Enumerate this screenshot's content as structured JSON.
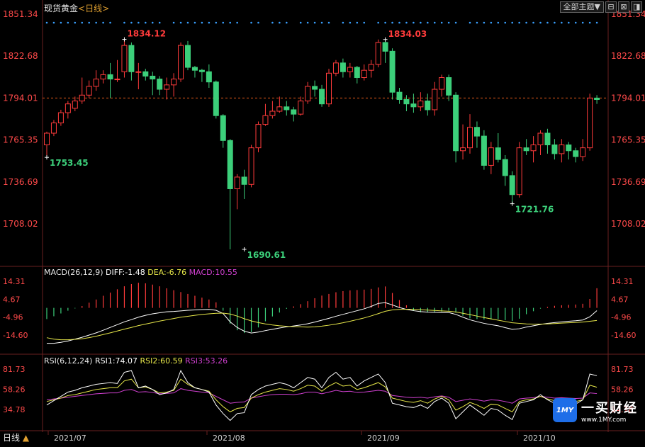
{
  "header": {
    "title": "现货黄金",
    "period": "<日线>"
  },
  "toolbar": {
    "theme_label": "全部主题▼",
    "b1": "⊟",
    "b2": "⊠",
    "b3": "◨"
  },
  "timeframe": {
    "label": "日线",
    "arrow": "▲"
  },
  "brand": {
    "logo_text": "1MY",
    "name": "一买财经",
    "url": "www.1MY.com"
  },
  "colors": {
    "up": "#ff3b3b",
    "down": "#3ccf7a",
    "axis_text": "#ff4a4a",
    "ref_line": "#e05a1a",
    "diff": "#ffffff",
    "dea": "#e8e84a",
    "macd": "#d040d0",
    "rsi1": "#ffffff",
    "rsi2": "#e8e84a",
    "rsi3": "#d040d0",
    "dots": "#3aa0ff"
  },
  "chart_data": [
    {
      "name": "price",
      "type": "candlestick",
      "y_ticks": [
        "1851.34",
        "1822.68",
        "1794.01",
        "1765.35",
        "1736.69",
        "1708.02"
      ],
      "ylim": [
        1690.61,
        1851.34
      ],
      "reference_line": 1794.01,
      "x_ticks": [
        "2021/07",
        "2021/08",
        "2021/09",
        "2021/10"
      ],
      "annotations": [
        {
          "label": "1834.12",
          "value": 1834.12,
          "index": 11,
          "kind": "high"
        },
        {
          "label": "1753.45",
          "value": 1753.45,
          "index": 0,
          "kind": "low"
        },
        {
          "label": "1690.61",
          "value": 1690.61,
          "index": 28,
          "kind": "low"
        },
        {
          "label": "1834.03",
          "value": 1834.03,
          "index": 48,
          "kind": "high"
        },
        {
          "label": "1721.76",
          "value": 1721.76,
          "index": 66,
          "kind": "low"
        }
      ],
      "candles": [
        [
          1762,
          1770,
          1753.45,
          1771
        ],
        [
          1770,
          1777,
          1768,
          1779
        ],
        [
          1777,
          1784,
          1775,
          1786
        ],
        [
          1784,
          1790,
          1780,
          1792
        ],
        [
          1787,
          1792,
          1785,
          1795
        ],
        [
          1792,
          1796,
          1790,
          1808
        ],
        [
          1796,
          1802,
          1794,
          1806
        ],
        [
          1802,
          1807,
          1799,
          1813
        ],
        [
          1807,
          1810,
          1804,
          1813
        ],
        [
          1810,
          1807,
          1794,
          1818
        ],
        [
          1807,
          1807,
          1805,
          1820
        ],
        [
          1812,
          1830,
          1808,
          1834.12
        ],
        [
          1830,
          1812,
          1806,
          1832
        ],
        [
          1812,
          1812,
          1800,
          1818
        ],
        [
          1812,
          1809,
          1806,
          1814
        ],
        [
          1809,
          1807,
          1796,
          1812
        ],
        [
          1807,
          1800,
          1796,
          1809
        ],
        [
          1800,
          1803,
          1793,
          1808
        ],
        [
          1803,
          1807,
          1795,
          1811
        ],
        [
          1807,
          1830,
          1805,
          1832
        ],
        [
          1830,
          1815,
          1813,
          1833
        ],
        [
          1815,
          1813,
          1808,
          1816
        ],
        [
          1813,
          1812,
          1805,
          1814
        ],
        [
          1812,
          1805,
          1801,
          1817
        ],
        [
          1805,
          1782,
          1780,
          1806
        ],
        [
          1782,
          1765,
          1760,
          1783
        ],
        [
          1765,
          1732,
          1690.61,
          1766
        ],
        [
          1732,
          1740,
          1718,
          1742
        ],
        [
          1740,
          1735,
          1725,
          1745
        ],
        [
          1735,
          1760,
          1733,
          1762
        ],
        [
          1760,
          1776,
          1757,
          1778
        ],
        [
          1776,
          1782,
          1775,
          1790
        ],
        [
          1782,
          1785,
          1780,
          1792
        ],
        [
          1785,
          1788,
          1784,
          1795
        ],
        [
          1788,
          1786,
          1782,
          1792
        ],
        [
          1786,
          1783,
          1778,
          1788
        ],
        [
          1783,
          1792,
          1782,
          1795
        ],
        [
          1792,
          1802,
          1790,
          1805
        ],
        [
          1802,
          1800,
          1795,
          1806
        ],
        [
          1800,
          1790,
          1788,
          1803
        ],
        [
          1790,
          1811,
          1788,
          1814
        ],
        [
          1811,
          1818,
          1809,
          1820
        ],
        [
          1818,
          1812,
          1808,
          1821
        ],
        [
          1812,
          1815,
          1808,
          1818
        ],
        [
          1815,
          1808,
          1804,
          1816
        ],
        [
          1808,
          1813,
          1806,
          1817
        ],
        [
          1813,
          1817,
          1808,
          1820
        ],
        [
          1817,
          1832,
          1815,
          1834.03
        ],
        [
          1832,
          1826,
          1818,
          1833
        ],
        [
          1826,
          1798,
          1793,
          1828
        ],
        [
          1798,
          1793,
          1790,
          1801
        ],
        [
          1793,
          1790,
          1785,
          1796
        ],
        [
          1790,
          1788,
          1784,
          1797
        ],
        [
          1788,
          1792,
          1785,
          1798
        ],
        [
          1792,
          1786,
          1782,
          1797
        ],
        [
          1786,
          1800,
          1782,
          1805
        ],
        [
          1800,
          1808,
          1795,
          1810
        ],
        [
          1808,
          1796,
          1792,
          1810
        ],
        [
          1796,
          1758,
          1750,
          1798
        ],
        [
          1758,
          1760,
          1752,
          1776
        ],
        [
          1760,
          1774,
          1756,
          1783
        ],
        [
          1774,
          1768,
          1760,
          1778
        ],
        [
          1768,
          1748,
          1745,
          1772
        ],
        [
          1748,
          1760,
          1742,
          1764
        ],
        [
          1760,
          1752,
          1750,
          1770
        ],
        [
          1752,
          1741,
          1734,
          1755
        ],
        [
          1741,
          1728,
          1721.76,
          1744
        ],
        [
          1728,
          1760,
          1726,
          1764
        ],
        [
          1760,
          1758,
          1755,
          1766
        ],
        [
          1758,
          1762,
          1750,
          1768
        ],
        [
          1762,
          1770,
          1755,
          1772
        ],
        [
          1770,
          1762,
          1756,
          1773
        ],
        [
          1762,
          1756,
          1752,
          1766
        ],
        [
          1756,
          1762,
          1750,
          1766
        ],
        [
          1762,
          1758,
          1752,
          1764
        ],
        [
          1758,
          1754,
          1750,
          1760
        ],
        [
          1754,
          1760,
          1751,
          1766
        ],
        [
          1760,
          1794,
          1758,
          1797
        ],
        [
          1794,
          1793,
          1790,
          1796
        ]
      ]
    },
    {
      "name": "macd",
      "type": "bar+line",
      "label": "MACD(26,12,9)",
      "diff_label": "DIFF:-1.48",
      "dea_label": "DEA:-6.76",
      "macd_label": "MACD:10.55",
      "y_ticks": [
        "14.31",
        "4.67",
        "-4.96",
        "-14.60"
      ],
      "ylim": [
        -20,
        17
      ],
      "diff": [
        -19,
        -19,
        -18.5,
        -17.8,
        -16.8,
        -15.8,
        -14.6,
        -13.4,
        -12,
        -10.5,
        -9,
        -7.5,
        -6.3,
        -5,
        -4,
        -3.2,
        -2.6,
        -2.1,
        -1.9,
        -1.6,
        -1.3,
        -1.1,
        -0.9,
        -0.8,
        -1.3,
        -3,
        -7.5,
        -10.5,
        -12.5,
        -13.5,
        -13,
        -12.2,
        -11.5,
        -10.8,
        -10.2,
        -9.7,
        -9.2,
        -8.5,
        -7.6,
        -6.6,
        -5.6,
        -4.5,
        -3.5,
        -2.5,
        -1.5,
        -0.5,
        0.8,
        2.4,
        2.8,
        1.6,
        0.2,
        -0.8,
        -1.5,
        -2,
        -2.3,
        -2.4,
        -2.5,
        -2.5,
        -3.5,
        -5,
        -6.4,
        -7.4,
        -8.3,
        -9,
        -9.6,
        -10.6,
        -11.5,
        -11.2,
        -10.3,
        -9.6,
        -8.9,
        -8.3,
        -7.9,
        -7.5,
        -7.2,
        -6.9,
        -6.5,
        -4.8,
        -1.48
      ],
      "dea": [
        -16,
        -16.8,
        -17.1,
        -17.1,
        -16.9,
        -16.6,
        -16,
        -15.2,
        -14.3,
        -13.4,
        -12.4,
        -11.4,
        -10.5,
        -9.5,
        -8.7,
        -7.9,
        -7.1,
        -6.4,
        -5.7,
        -5,
        -4.5,
        -4,
        -3.5,
        -3.2,
        -2.9,
        -2.8,
        -3.3,
        -4.4,
        -5.8,
        -7,
        -7.9,
        -8.6,
        -9.2,
        -9.6,
        -9.9,
        -10.1,
        -10.2,
        -10.3,
        -10.2,
        -9.8,
        -9.3,
        -8.7,
        -8,
        -7.2,
        -6.3,
        -5.4,
        -4.3,
        -3.1,
        -1.8,
        -1.1,
        -0.8,
        -0.7,
        -0.8,
        -1,
        -1.2,
        -1.4,
        -1.6,
        -1.8,
        -2.2,
        -2.9,
        -3.6,
        -4.4,
        -5.2,
        -5.9,
        -6.6,
        -7.3,
        -8,
        -8.3,
        -8.6,
        -8.7,
        -8.7,
        -8.6,
        -8.4,
        -8.2,
        -8,
        -7.8,
        -7.6,
        -7.2,
        -6.76
      ],
      "hist": [
        -6,
        -4.5,
        -3,
        -1.5,
        -0.3,
        1,
        2.8,
        4.5,
        6.5,
        8.2,
        10,
        11.6,
        12.8,
        13.5,
        13.2,
        12.5,
        11.6,
        10.5,
        9.5,
        8.5,
        7.5,
        6.5,
        5.5,
        4.5,
        3,
        -1.5,
        -8.5,
        -12,
        -13.5,
        -13,
        -10.5,
        -7.2,
        -4.6,
        -2.5,
        -0.5,
        0.8,
        2,
        3.6,
        5.2,
        6.6,
        7.5,
        8.4,
        9,
        9.4,
        9.6,
        9.8,
        10.2,
        11,
        11.5,
        8,
        4.2,
        1.4,
        -1.5,
        -2.4,
        -2.4,
        -2.2,
        -2,
        -1.5,
        -2.6,
        -4.2,
        -5.6,
        -6,
        -6.2,
        -6.2,
        -6,
        -6.6,
        -7,
        -5.8,
        -3.4,
        -1.8,
        -0.4,
        0.6,
        1.1,
        1.4,
        1.6,
        1.8,
        2.2,
        4.8,
        10.55
      ]
    },
    {
      "name": "rsi",
      "type": "line",
      "label": "RSI(6,12,24)",
      "rsi1_label": "RSI1:74.07",
      "rsi2_label": "RSI2:60.59",
      "rsi3_label": "RSI3:53.26",
      "y_ticks": [
        "81.73",
        "58.26",
        "34.78"
      ],
      "ylim": [
        20,
        90
      ],
      "rsi1": [
        40,
        45,
        50,
        55,
        57,
        60,
        62,
        64,
        65,
        66,
        65,
        78,
        80,
        60,
        62,
        58,
        52,
        54,
        58,
        80,
        66,
        60,
        58,
        55,
        40,
        30,
        22,
        30,
        31,
        52,
        58,
        62,
        64,
        66,
        64,
        60,
        66,
        72,
        70,
        60,
        72,
        78,
        70,
        72,
        62,
        68,
        72,
        76,
        66,
        42,
        40,
        38,
        37,
        40,
        36,
        44,
        48,
        42,
        24,
        32,
        40,
        34,
        28,
        36,
        34,
        28,
        23,
        42,
        44,
        46,
        52,
        46,
        42,
        46,
        44,
        41,
        46,
        76,
        74.07
      ],
      "rsi2": [
        44,
        46,
        48,
        51,
        52,
        54,
        56,
        58,
        59,
        60,
        60,
        68,
        70,
        60,
        61,
        58,
        54,
        55,
        57,
        70,
        64,
        60,
        58,
        56,
        46,
        38,
        32,
        36,
        37,
        48,
        52,
        55,
        57,
        59,
        58,
        56,
        59,
        63,
        62,
        56,
        62,
        66,
        62,
        63,
        58,
        60,
        63,
        66,
        61,
        48,
        46,
        44,
        43,
        45,
        42,
        47,
        50,
        46,
        34,
        38,
        43,
        40,
        36,
        41,
        40,
        36,
        32,
        44,
        46,
        47,
        50,
        47,
        45,
        47,
        46,
        44,
        46,
        63,
        60.59
      ],
      "rsi3": [
        46,
        47,
        48,
        49,
        50,
        51,
        52,
        53,
        53.5,
        54,
        54,
        57,
        58,
        55,
        55.5,
        54.5,
        53,
        53.5,
        54,
        59,
        57,
        56,
        55,
        54,
        50,
        46,
        42,
        43,
        43.5,
        48,
        49.5,
        51,
        52,
        52.5,
        52.5,
        52,
        53,
        55,
        55,
        53,
        55,
        57,
        55.5,
        56,
        54.5,
        55,
        56,
        57,
        56,
        51,
        50,
        49,
        48.5,
        49,
        48,
        49.5,
        50.5,
        49,
        44,
        45.5,
        47,
        46,
        44.5,
        46,
        45.5,
        44,
        42,
        47,
        48,
        48.5,
        50,
        49,
        48,
        48.5,
        48,
        47.5,
        48,
        54,
        53.26
      ]
    }
  ]
}
